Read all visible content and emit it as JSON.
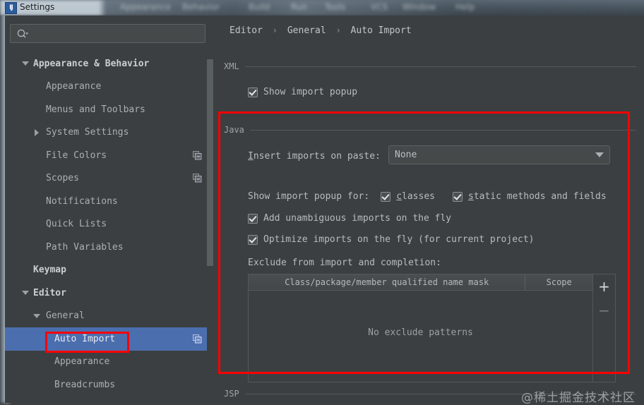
{
  "window": {
    "title": "Settings",
    "app_icon": "intellij-idea-icon",
    "menubar_ghost": [
      "Appearance",
      "Behavior",
      "Build",
      "Run",
      "Tools",
      "VCS",
      "Window",
      "Help"
    ]
  },
  "search": {
    "value": "",
    "placeholder": "",
    "icon": "search-icon"
  },
  "sidebar": {
    "items": [
      {
        "label": "Appearance & Behavior",
        "indent": 22,
        "twisty": "down",
        "bold": true,
        "selected": false,
        "copy_icon": false
      },
      {
        "label": "Appearance",
        "indent": 58,
        "twisty": "none",
        "bold": false,
        "selected": false,
        "copy_icon": false
      },
      {
        "label": "Menus and Toolbars",
        "indent": 58,
        "twisty": "none",
        "bold": false,
        "selected": false,
        "copy_icon": false
      },
      {
        "label": "System Settings",
        "indent": 58,
        "twisty": "right",
        "bold": false,
        "selected": false,
        "copy_icon": false
      },
      {
        "label": "File Colors",
        "indent": 58,
        "twisty": "none",
        "bold": false,
        "selected": false,
        "copy_icon": true
      },
      {
        "label": "Scopes",
        "indent": 58,
        "twisty": "none",
        "bold": false,
        "selected": false,
        "copy_icon": true
      },
      {
        "label": "Notifications",
        "indent": 58,
        "twisty": "none",
        "bold": false,
        "selected": false,
        "copy_icon": false
      },
      {
        "label": "Quick Lists",
        "indent": 58,
        "twisty": "none",
        "bold": false,
        "selected": false,
        "copy_icon": false
      },
      {
        "label": "Path Variables",
        "indent": 58,
        "twisty": "none",
        "bold": false,
        "selected": false,
        "copy_icon": false
      },
      {
        "label": "Keymap",
        "indent": 40,
        "twisty": "none",
        "bold": true,
        "selected": false,
        "copy_icon": false
      },
      {
        "label": "Editor",
        "indent": 40,
        "twisty": "down",
        "bold": true,
        "selected": false,
        "copy_icon": false
      },
      {
        "label": "General",
        "indent": 58,
        "twisty": "down",
        "bold": false,
        "selected": false,
        "copy_icon": false
      },
      {
        "label": "Auto Import",
        "indent": 70,
        "twisty": "none",
        "bold": false,
        "selected": true,
        "copy_icon": true
      },
      {
        "label": "Appearance",
        "indent": 70,
        "twisty": "none",
        "bold": false,
        "selected": false,
        "copy_icon": false
      },
      {
        "label": "Breadcrumbs",
        "indent": 70,
        "twisty": "none",
        "bold": false,
        "selected": false,
        "copy_icon": false
      }
    ]
  },
  "breadcrumb": {
    "parts": [
      "Editor",
      "General",
      "Auto Import"
    ],
    "separator": "›"
  },
  "sections": {
    "xml": {
      "title": "XML",
      "show_import_popup": {
        "label": "Show import popup",
        "checked": true
      }
    },
    "java": {
      "title": "Java",
      "insert_imports_label": "Insert imports on paste:",
      "insert_imports_label_mnemonic": "I",
      "insert_imports_value": "None",
      "show_import_popup_for_label": "Show import popup for:",
      "classes": {
        "label": "classes",
        "mnemonic": "c",
        "checked": true
      },
      "static_methods": {
        "label": "static methods and fields",
        "mnemonic": "s",
        "checked": true
      },
      "add_unambiguous": {
        "label": "Add unambiguous imports on the fly",
        "checked": true
      },
      "optimize_imports": {
        "label": "Optimize imports on the fly (for current project)",
        "checked": true
      },
      "exclude_label": "Exclude from import and completion:",
      "table": {
        "columns": [
          "Class/package/member qualified name mask",
          "Scope"
        ],
        "rows": [],
        "empty_text": "No exclude patterns",
        "add_button": "+",
        "remove_button": "−"
      }
    },
    "jsp": {
      "title": "JSP"
    }
  },
  "watermark": "@稀土掘金技术社区",
  "colors": {
    "background": "#3c3f41",
    "selection": "#4b6eaf",
    "annotation": "#fe0000",
    "text": "#b6bcc0",
    "border": "#53585b"
  }
}
